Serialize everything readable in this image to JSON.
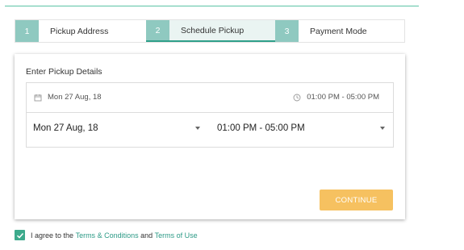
{
  "steps": [
    {
      "number": "1",
      "label": "Pickup Address"
    },
    {
      "number": "2",
      "label": "Schedule Pickup"
    },
    {
      "number": "3",
      "label": "Payment Mode"
    }
  ],
  "pickup": {
    "title": "Enter Pickup Details",
    "summary_date": "Mon 27 Aug, 18",
    "summary_time": "01:00 PM - 05:00 PM",
    "date_select": "Mon 27 Aug, 18",
    "time_select": "01:00 PM - 05:00 PM",
    "continue_label": "CONTINUE"
  },
  "agreement": {
    "prefix": "I agree to the",
    "terms_link": "Terms & Conditions",
    "and": "and",
    "terms_of_use_link": "Terms of Use",
    "checked": true
  },
  "colors": {
    "accent": "#2fa08a",
    "step_number_bg": "#8fc9c0",
    "button": "#f6c160",
    "checkbox": "#3daa8c"
  },
  "icons": [
    "calendar-icon",
    "clock-icon",
    "chevron-down-icon",
    "checkmark-icon"
  ]
}
